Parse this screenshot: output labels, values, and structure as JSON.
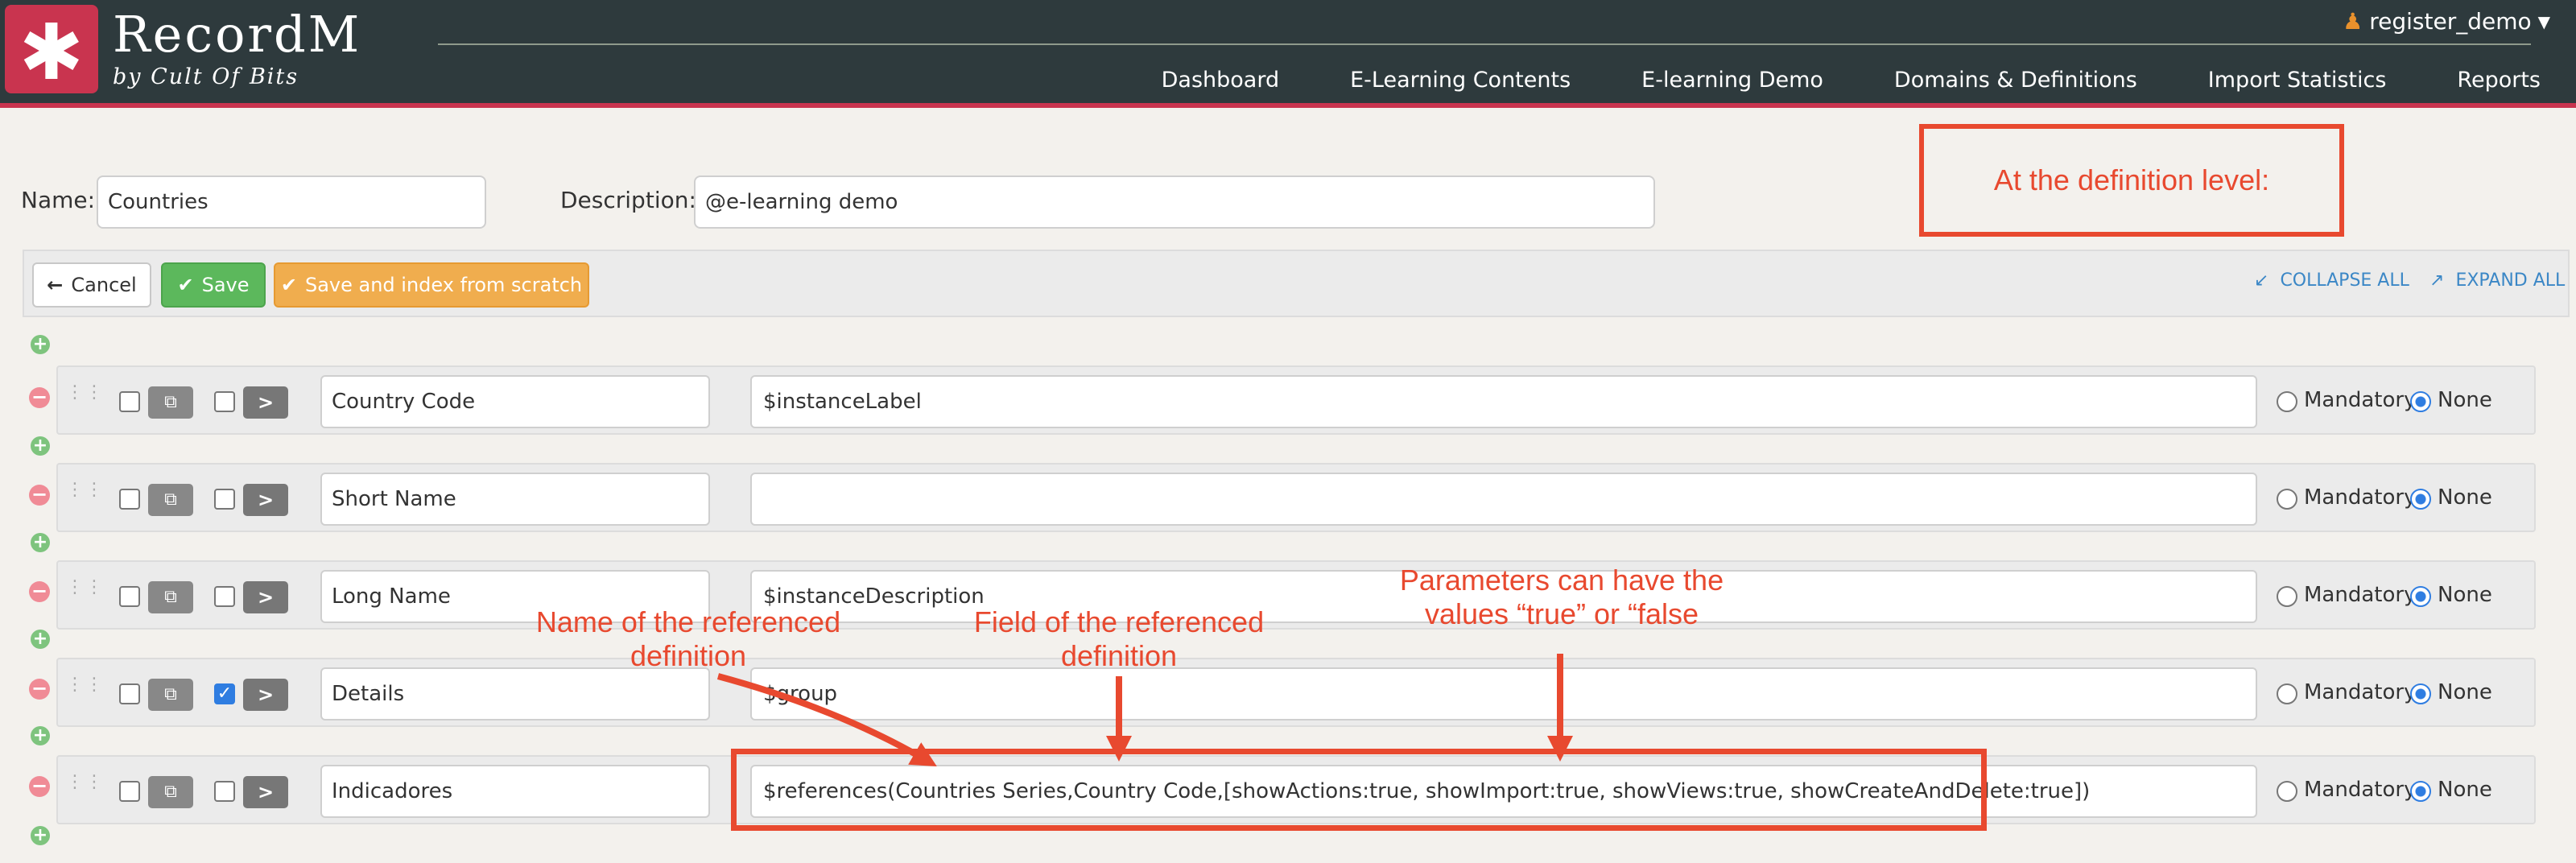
{
  "header": {
    "logo_symbol": "✱",
    "brand": "RecordM",
    "brand_sub": "by Cult Of Bits",
    "user": "register_demo",
    "user_icon": "person-icon",
    "nav": [
      "Dashboard",
      "E-Learning Contents",
      "E-learning Demo",
      "Domains & Definitions",
      "Import Statistics",
      "Reports"
    ]
  },
  "form": {
    "name_label": "Name:",
    "name_value": "Countries",
    "description_label": "Description:",
    "description_value": "@e-learning demo"
  },
  "toolbar": {
    "cancel": "Cancel",
    "save": "Save",
    "save_index": "Save and index from scratch",
    "collapse_all": "COLLAPSE ALL",
    "expand_all": "EXPAND ALL"
  },
  "fields": [
    {
      "name": "Country Code",
      "description": "$instanceLabel",
      "checked": false,
      "mandatory": false
    },
    {
      "name": "Short Name",
      "description": "",
      "checked": false,
      "mandatory": false
    },
    {
      "name": "Long Name",
      "description": "$instanceDescription",
      "checked": false,
      "mandatory": false
    },
    {
      "name": "Details",
      "description": "$group",
      "checked": true,
      "mandatory": false
    },
    {
      "name": "Indicadores",
      "description": "$references(Countries Series,Country Code,[showActions:true, showImport:true, showViews:true, showCreateAndDelete:true])",
      "checked": false,
      "mandatory": false
    }
  ],
  "radio_labels": {
    "mandatory": "Mandatory",
    "none": "None"
  },
  "annotations": {
    "definition_level": "At the definition level:",
    "referenced_name": [
      "Name of the referenced",
      "definition"
    ],
    "referenced_field": [
      "Field of the referenced",
      "definition"
    ],
    "parameters": [
      "Parameters can have the",
      "values “true” or “false"
    ]
  },
  "colors": {
    "accent": "#c9344f",
    "header": "#2e3a3d",
    "annotation": "#e8492f",
    "save": "#5cb85c",
    "index": "#f0ad4e"
  }
}
